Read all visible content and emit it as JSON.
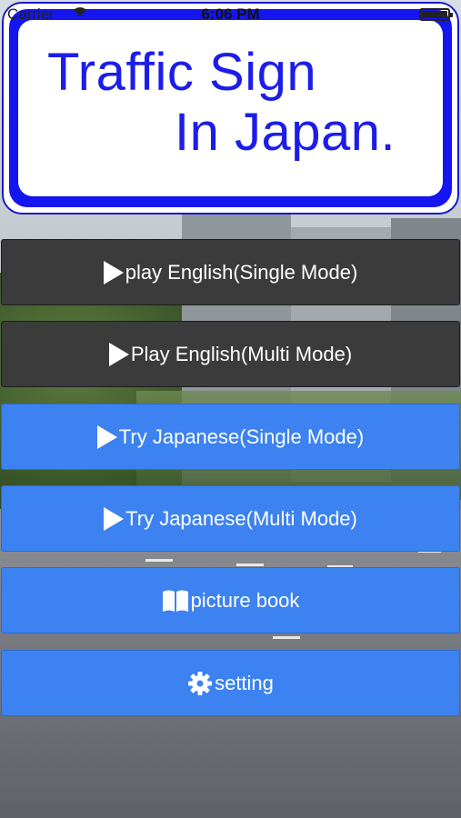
{
  "status_bar": {
    "carrier": "Carrier",
    "time": "6:06 PM"
  },
  "title_sign": {
    "line1": "Traffic Sign",
    "line2": "In Japan."
  },
  "menu": {
    "items": [
      {
        "label": "play English(Single Mode)",
        "icon": "play-icon",
        "color": "#3b3b3b"
      },
      {
        "label": "Play English(Multi Mode)",
        "icon": "play-icon",
        "color": "#3b3b3b"
      },
      {
        "label": "Try Japanese(Single Mode)",
        "icon": "play-icon",
        "color": "#3c82f0"
      },
      {
        "label": "Try Japanese(Multi Mode)",
        "icon": "play-icon",
        "color": "#3c82f0"
      },
      {
        "label": "picture book",
        "icon": "book-icon",
        "color": "#3c82f0"
      },
      {
        "label": "setting",
        "icon": "gear-icon",
        "color": "#3c82f0"
      }
    ]
  },
  "colors": {
    "sign_blue": "#1515f0",
    "sign_text": "#1d1de8"
  }
}
